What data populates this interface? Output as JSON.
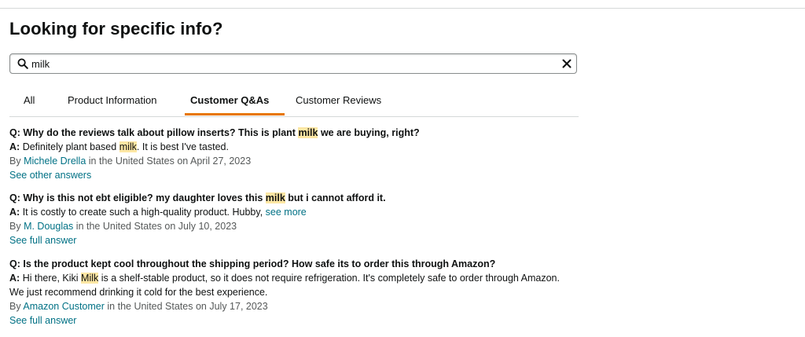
{
  "heading": "Looking for specific info?",
  "search": {
    "value": "milk",
    "icon": "search-icon",
    "clear_icon": "close-icon"
  },
  "tabs": [
    "All",
    "Product Information",
    "Customer Q&As",
    "Customer Reviews"
  ],
  "active_tab": "Customer Q&As",
  "accent_color": "#e77600",
  "link_color": "#007185",
  "highlight_color": "#fde7a4",
  "questions": [
    {
      "q_prefix": "Q:",
      "q_before": "Why do the reviews talk about pillow inserts? This is plant",
      "q_hl": "milk",
      "q_after": "we are buying, right?",
      "a_prefix": "A:",
      "a_before": "Definitely plant based",
      "a_hl": "milk",
      "a_after": ". It is best I've tasted.",
      "by": "By",
      "author": "Michele Drella",
      "location_date": "in the United States on April 27, 2023",
      "more_link": "See other answers"
    },
    {
      "q_prefix": "Q:",
      "q_before": "Why is this not ebt eligible? my daughter loves this",
      "q_hl": "milk",
      "q_after": "but i cannot afford it.",
      "a_prefix": "A:",
      "a_text": "It is costly to create such a high-quality product. Hubby,",
      "see_more": "see more",
      "by": "By",
      "author": "M. Douglas",
      "location_date": "in the United States on July 10, 2023",
      "more_link": "See full answer"
    },
    {
      "q_prefix": "Q:",
      "q_text": "Is the product kept cool throughout the shipping period? How safe its to order this through Amazon?",
      "a_prefix": "A:",
      "a_before": "Hi there, Kiki",
      "a_hl": "Milk",
      "a_after": "is a shelf-stable product, so it does not require refrigeration. It's completely safe to order through Amazon. We just recommend drinking it cold for the best experience.",
      "by": "By",
      "author": "Amazon Customer",
      "location_date": "in the United States on July 17, 2023",
      "more_link": "See full answer"
    }
  ]
}
